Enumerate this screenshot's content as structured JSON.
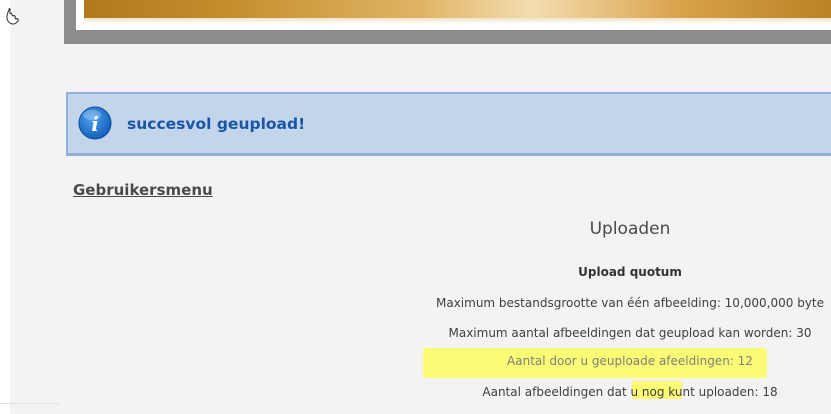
{
  "notice": {
    "icon": "info-icon",
    "message": "succesvol geupload!"
  },
  "user_menu": {
    "label": "Gebruikersmenu"
  },
  "upload": {
    "title": "Uploaden",
    "quota_title": "Upload quotum",
    "lines": [
      "Maximum bestandsgrootte van één afbeelding: 10,000,000 byte",
      "Maximum aantal afbeeldingen dat geupload kan worden: 30",
      "Aantal door u geuploade afeeldingen: 12",
      "Aantal afbeeldingen dat u nog kunt uploaden: 18"
    ]
  },
  "colors": {
    "notice_bg": "#c3d5ea",
    "notice_border": "#8eb0da",
    "notice_text": "#1b56a6",
    "highlight": "#fbfb74"
  }
}
